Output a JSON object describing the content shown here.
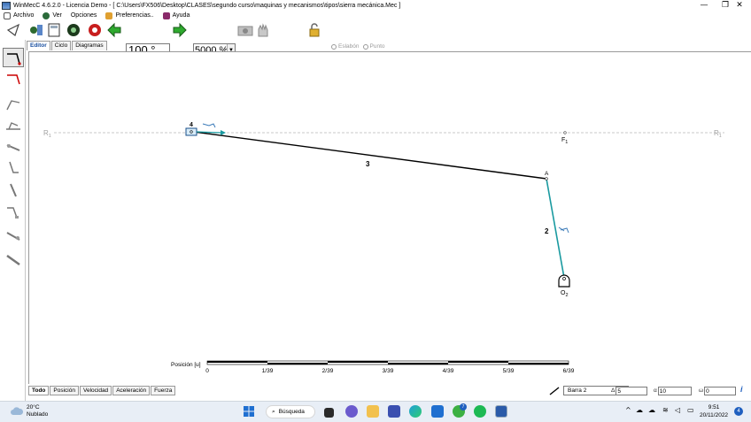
{
  "window": {
    "title": "WinMecC 4.6.2.0 - Licencia Demo - [ C:\\Users\\FX506\\Desktop\\CLASES\\segundo curso\\maquinas y mecanismos\\tipos\\sierra mecánica.Mec ]",
    "minimize": "—",
    "maximize": "❐",
    "close": "✕"
  },
  "menu": {
    "items": [
      "Archivo",
      "Ver",
      "Opciones",
      "Preferencias..",
      "Ayuda"
    ]
  },
  "toolbar": {
    "angle_value": "100 °",
    "zoom_value": "5000 %",
    "radio_eslabon": "Eslabón",
    "radio_punto": "Punto"
  },
  "tabs_top": [
    "Editor",
    "Ciclo",
    "Diagramas"
  ],
  "tabs_bottom": [
    "Todo",
    "Posición",
    "Velocidad",
    "Aceleración",
    "Fuerza"
  ],
  "canvas": {
    "ref_left": "R1",
    "ref_right": "R1",
    "point_F1": "F1",
    "point_A": "A",
    "point_O2": "O2",
    "link_2": "2",
    "link_3": "3",
    "link_4": "4",
    "scale_label": "Posición [u]",
    "scale_ticks": [
      "0",
      "1/39",
      "2/39",
      "3/39",
      "4/39",
      "5/39",
      "6/39"
    ]
  },
  "statusbar": {
    "bar_select": "Barra 2",
    "delta_label": "Δ",
    "delta_value": "5",
    "alpha_label": "α",
    "alpha_value": "10",
    "omega_label": "ω",
    "omega_value": "0",
    "info": "i"
  },
  "taskbar": {
    "temperature": "20°C",
    "weather": "Nublado",
    "search": "Búsqueda",
    "time": "9:51",
    "date": "20/11/2022",
    "notifications": "4",
    "teams_badge": "7"
  },
  "colors": {
    "link_cyan": "#1a9aa0",
    "link_black": "#000000",
    "ref_line": "#b0b0b0",
    "scale_bar": "#000000",
    "accent": "#1f5fbf"
  }
}
